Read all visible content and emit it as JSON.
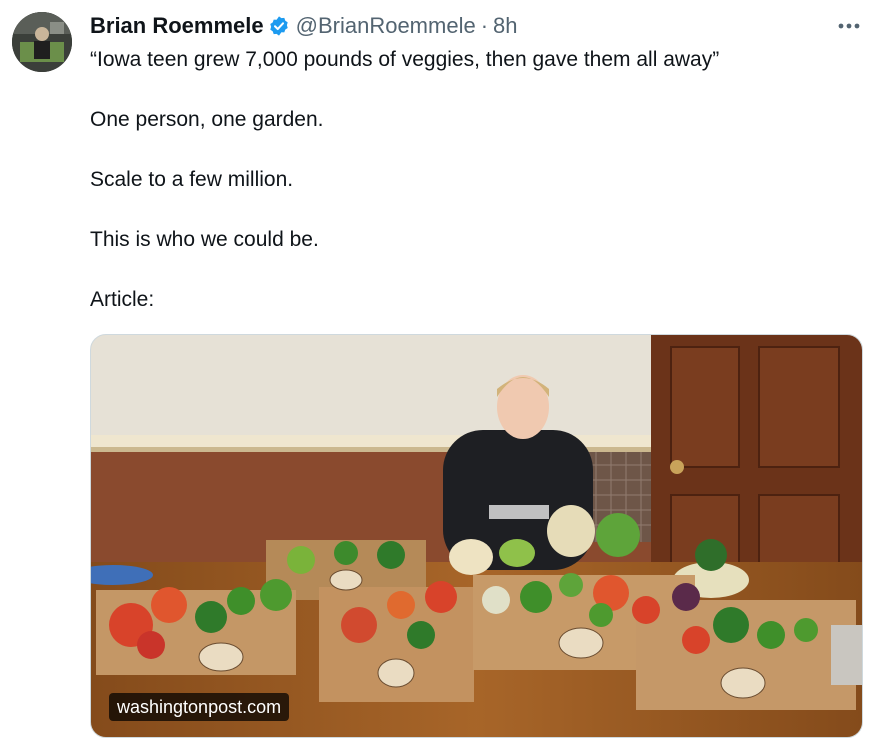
{
  "author": {
    "display_name": "Brian Roemmele",
    "handle": "@BrianRoemmele",
    "separator": "·",
    "time": "8h",
    "verified_icon": "verified-badge-icon",
    "verified_color": "#1d9bf0"
  },
  "tweet": {
    "paragraphs": [
      "“Iowa teen grew 7,000 pounds of veggies, then gave them all away”",
      "One person, one garden.",
      "Scale to a few million.",
      "This is who we could be.",
      "Article:"
    ]
  },
  "card": {
    "domain": "washingtonpost.com",
    "image_description_icon": "photo"
  },
  "icons": {
    "more": "more-options-icon"
  },
  "colors": {
    "text_primary": "#0f1419",
    "text_secondary": "#536471",
    "border": "#cfd9de"
  }
}
